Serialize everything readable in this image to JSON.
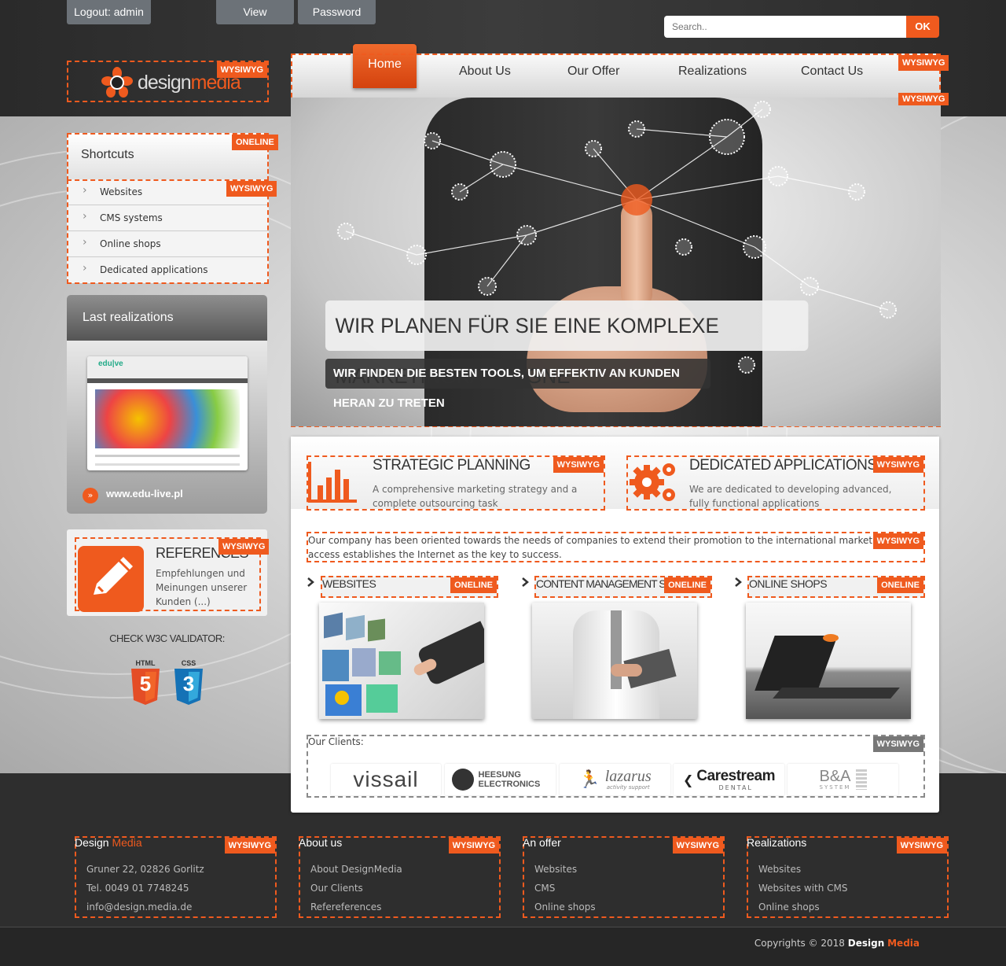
{
  "topbar": {
    "logout_label": "Logout: admin",
    "view_label": "View",
    "password_label": "Password",
    "search_placeholder": "Search..",
    "ok_label": "OK"
  },
  "logo": {
    "text_a": "design",
    "text_b": "media"
  },
  "tags": {
    "wysiwyg": "WYSIWYG",
    "oneline": "ONELINE"
  },
  "nav": {
    "items": [
      "Home",
      "About Us",
      "Our Offer",
      "Realizations",
      "Contact Us"
    ],
    "active_index": 0
  },
  "hero": {
    "title": "WIR PLANEN FÜR SIE EINE KOMPLEXE MARKETINGKAMPAGNE",
    "subtitle": "WIR FINDEN DIE BESTEN TOOLS, UM EFFEKTIV AN KUNDEN HERAN ZU TRETEN"
  },
  "sidebar": {
    "shortcuts_title": "Shortcuts",
    "shortcuts": [
      "Websites",
      "CMS systems",
      "Online shops",
      "Dedicated applications"
    ],
    "last_title": "Last realizations",
    "last_link": "www.edu-live.pl",
    "thumb_logo": "edu|ve",
    "references_title": "REFERENCES",
    "references_text": "Empfehlungen und Meinungen unserer Kunden (...)",
    "validator_title": "CHECK W3C VALIDATOR:",
    "html_label": "HTML",
    "css_label": "CSS",
    "html_digit": "5",
    "css_digit": "3"
  },
  "features": [
    {
      "title": "STRATEGIC PLANNING",
      "text": "A comprehensive marketing strategy and a complete outsourcing task",
      "icon": "bar-chart-icon"
    },
    {
      "title": "DEDICATED APPLICATIONS",
      "text": "We are dedicated to developing advanced, fully functional applications",
      "icon": "gears-icon"
    }
  ],
  "intro_text": "Our company has been oriented towards the needs of companies to extend their promotion to the international market. The unlimited access establishes the Internet as the key to success.",
  "services": [
    {
      "title": "WEBSITES"
    },
    {
      "title": "CONTENT MANAGEMENT SYSTEMS"
    },
    {
      "title": "ONLINE SHOPS"
    }
  ],
  "clients": {
    "label": "Our Clients:",
    "logos": [
      "vissail",
      "HEESUNG ELECTRONICS",
      "lazarus",
      "Carestream",
      "B&A"
    ],
    "sub": [
      "",
      "",
      "activity support",
      "DENTAL",
      "SYSTEM"
    ]
  },
  "footer": {
    "col1": {
      "title_a": "Design",
      "title_b": "Media",
      "lines": [
        "Gruner 22, 02826 Gorlitz",
        "Tel. 0049 01 7748245",
        "info@design.media.de"
      ]
    },
    "col2": {
      "title": "About us",
      "lines": [
        "About DesignMedia",
        "Our Clients",
        "Refereferences"
      ]
    },
    "col3": {
      "title": "An offer",
      "lines": [
        "Websites",
        "CMS",
        "Online shops"
      ]
    },
    "col4": {
      "title": "Realizations",
      "lines": [
        "Websites",
        "Websites with CMS",
        "Online shops"
      ]
    },
    "copyright": "Copyrights © 2018",
    "brand_a": "Design",
    "brand_b": "Media"
  },
  "colors": {
    "accent": "#ef5a1e",
    "dark": "#2e2e2e"
  }
}
